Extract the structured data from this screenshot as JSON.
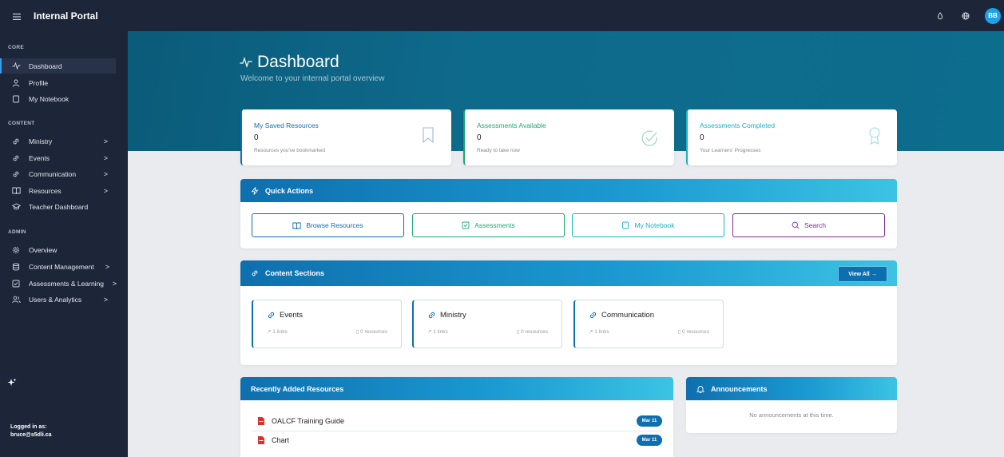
{
  "app": {
    "title": "Internal Portal",
    "user_initials": "BB"
  },
  "sidebar": {
    "sections": [
      {
        "heading": "CORE",
        "items": [
          {
            "label": "Dashboard",
            "icon": "activity-icon",
            "active": true
          },
          {
            "label": "Profile",
            "icon": "user-icon"
          },
          {
            "label": "My Notebook",
            "icon": "notebook-icon"
          }
        ]
      },
      {
        "heading": "CONTENT",
        "items": [
          {
            "label": "Ministry",
            "icon": "link-icon",
            "chevron": ">"
          },
          {
            "label": "Events",
            "icon": "link-icon",
            "chevron": ">"
          },
          {
            "label": "Communication",
            "icon": "link-icon",
            "chevron": ">"
          },
          {
            "label": "Resources",
            "icon": "book-icon",
            "chevron": ">"
          },
          {
            "label": "Teacher Dashboard",
            "icon": "graduation-icon"
          }
        ]
      },
      {
        "heading": "ADMIN",
        "items": [
          {
            "label": "Overview",
            "icon": "gear-icon"
          },
          {
            "label": "Content Management",
            "icon": "database-icon",
            "chevron": ">"
          },
          {
            "label": "Assessments & Learning",
            "icon": "checkbox-icon",
            "chevron": ">"
          },
          {
            "label": "Users & Analytics",
            "icon": "users-icon",
            "chevron": ">"
          }
        ]
      }
    ],
    "logged_in_label": "Logged in as:",
    "logged_in_user": "bruce@s5dli.ca"
  },
  "hero": {
    "title": "Dashboard",
    "subtitle": "Welcome to your internal portal overview"
  },
  "stats": [
    {
      "title": "My Saved Resources",
      "value": "0",
      "sub": "Resources you've bookmarked",
      "color": "#0e6fae",
      "icon": "bookmark-icon"
    },
    {
      "title": "Assessments Available",
      "value": "0",
      "sub": "Ready to take now",
      "color": "#1ea672",
      "icon": "check-circle-icon"
    },
    {
      "title": "Assessments Completed",
      "value": "0",
      "sub": "Your Learners' Progresses",
      "color": "#17b3c4",
      "icon": "award-icon"
    }
  ],
  "quick_actions": {
    "title": "Quick Actions",
    "buttons": [
      {
        "label": "Browse Resources",
        "color": "#0e6fae",
        "icon": "book-icon"
      },
      {
        "label": "Assessments",
        "color": "#1ea672",
        "icon": "checkbox-icon"
      },
      {
        "label": "My Notebook",
        "color": "#17b3c4",
        "icon": "notebook-icon"
      },
      {
        "label": "Search",
        "color": "#7b2c96",
        "icon": "search-icon"
      }
    ]
  },
  "content_sections": {
    "title": "Content Sections",
    "view_all": "View All →",
    "cards": [
      {
        "title": "Events",
        "links": "1 links",
        "resources": "0 resources"
      },
      {
        "title": "Ministry",
        "links": "1 links",
        "resources": "0 resources"
      },
      {
        "title": "Communication",
        "links": "1 links",
        "resources": "0 resources"
      }
    ]
  },
  "recent_resources": {
    "title": "Recently Added Resources",
    "items": [
      {
        "name": "OALCF Training Guide",
        "date": "Mar 11"
      },
      {
        "name": "Chart",
        "date": "Mar 11"
      }
    ]
  },
  "announcements": {
    "title": "Announcements",
    "empty": "No announcements at this time."
  }
}
